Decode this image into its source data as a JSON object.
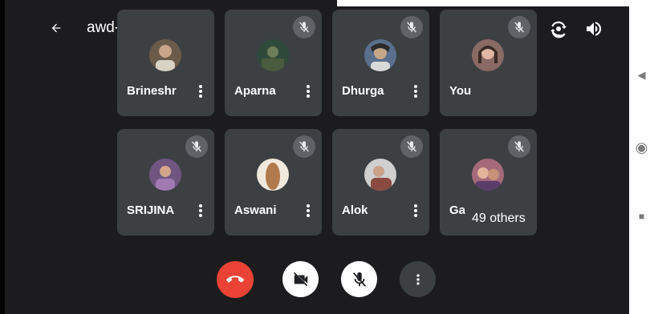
{
  "header": {
    "back_icon": "arrow-back-icon",
    "meeting_code": "awd-ukqw-ync",
    "chevron": "▸"
  },
  "participants": [
    {
      "name": "Brineshr",
      "muted": true,
      "avatar_color": "#6b5b4a"
    },
    {
      "name": "Aparna",
      "muted": false,
      "avatar_color": "#2f4a3a"
    },
    {
      "name": "Dhurga",
      "muted": true,
      "avatar_color": "#5a6f8c"
    },
    {
      "name": "You",
      "muted": true,
      "avatar_color": "#8a6a64"
    },
    {
      "name": "SRIJINA",
      "muted": true,
      "avatar_color": "#6f5580"
    },
    {
      "name": "Aswani",
      "muted": true,
      "avatar_color": "#b07a4d"
    },
    {
      "name": "Alok",
      "muted": true,
      "avatar_color": "#8a4a40"
    },
    {
      "name": "Ga",
      "muted": true,
      "avatar_color": "#a56a7a"
    }
  ],
  "others_label": "49 others",
  "controls": {
    "end_call_color": "#ea4335",
    "camera_off": true,
    "mic_off": true
  },
  "nav": {
    "back": "◀",
    "home": "◉",
    "recents": "■"
  }
}
